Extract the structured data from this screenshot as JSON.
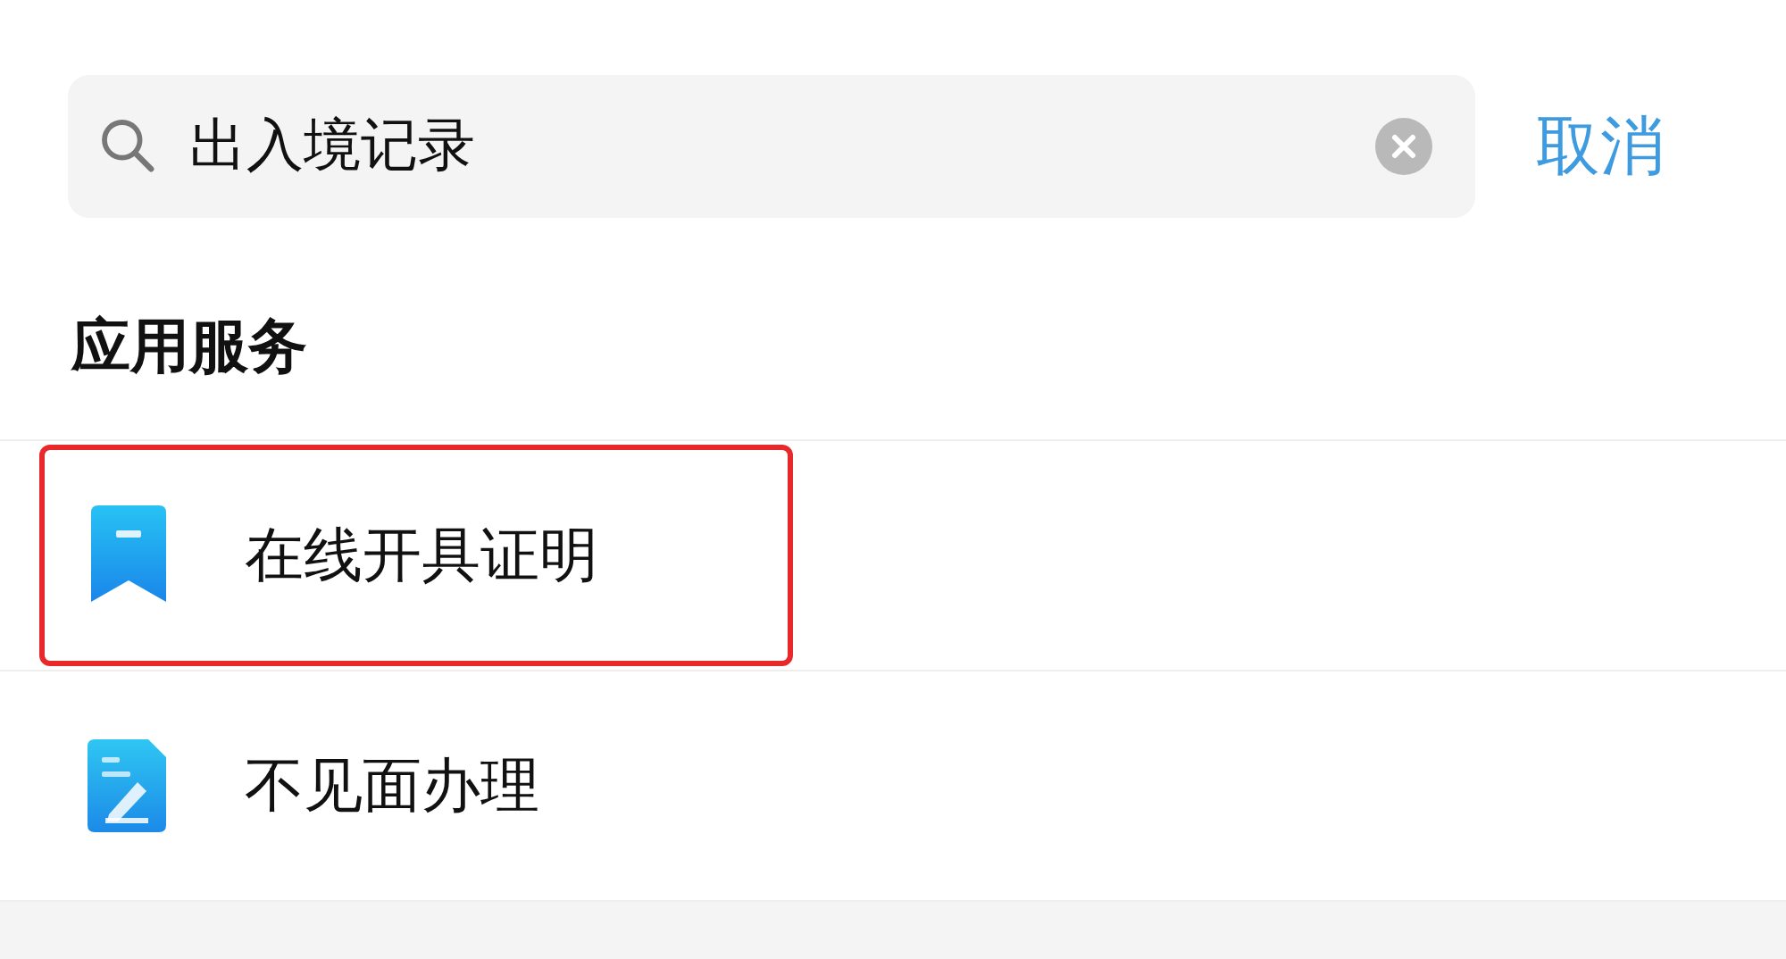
{
  "search": {
    "value": "出入境记录",
    "cancel": "取消"
  },
  "section": {
    "title": "应用服务",
    "items": [
      {
        "label": "在线开具证明",
        "kind": "bookmark",
        "highlighted": true
      },
      {
        "label": "不见面办理",
        "kind": "document",
        "highlighted": false
      }
    ]
  }
}
